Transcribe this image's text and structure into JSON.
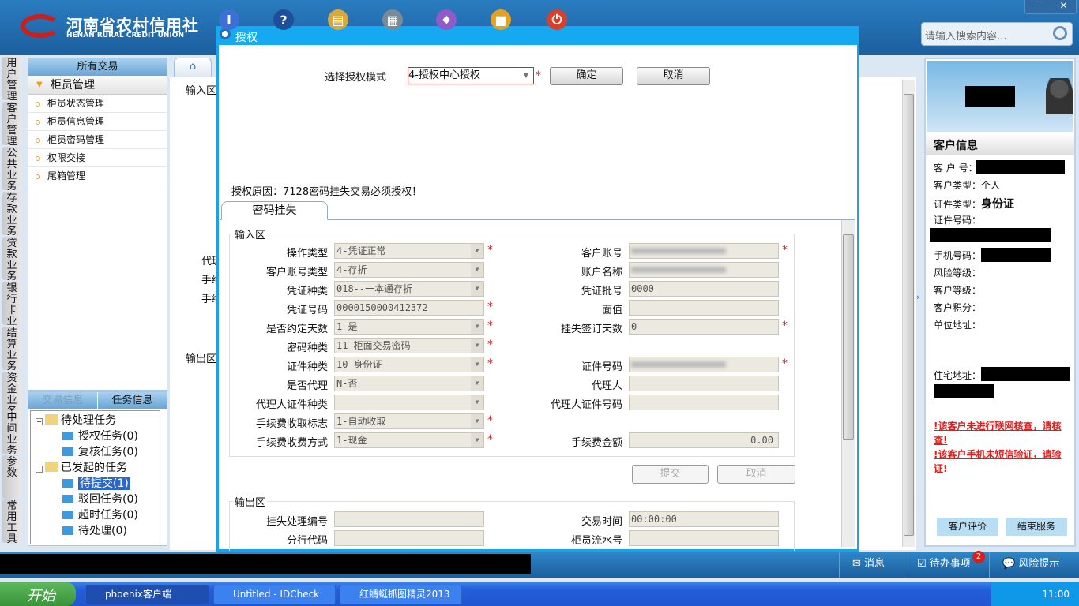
{
  "header": {
    "logo_cn": "河南省农村信用社",
    "logo_en": "HENAN RURAL CREDIT UNION",
    "search_placeholder": "请输入搜索内容...",
    "min": "—",
    "close": "✕",
    "icons": [
      {
        "name": "info-icon",
        "glyph": "i",
        "color": "#3d6fd6"
      },
      {
        "name": "help-icon",
        "glyph": "?",
        "color": "#1d4f9a"
      },
      {
        "name": "toolbox-icon",
        "glyph": "▤",
        "color": "#d9a73a"
      },
      {
        "name": "calculator-icon",
        "glyph": "▦",
        "color": "#7a8a96"
      },
      {
        "name": "skin-icon",
        "glyph": "♦",
        "color": "#8e5bc9"
      },
      {
        "name": "lock-icon",
        "glyph": "■",
        "color": "#e6a21f"
      },
      {
        "name": "power-icon",
        "glyph": "⏻",
        "color": "#d9402b"
      }
    ]
  },
  "vtabs": [
    "用户管理",
    "客户管理",
    "公共业务",
    "存款业务",
    "贷款业务",
    "银行卡业务",
    "结算业务",
    "资金业务",
    "中间业务",
    "参数",
    "常用工具"
  ],
  "sidebar": {
    "title": "所有交易",
    "group": "柜员管理",
    "items": [
      "柜员状态管理",
      "柜员信息管理",
      "柜员密码管理",
      "权限交接",
      "尾箱管理"
    ]
  },
  "tasks": {
    "tabs": [
      "交易信息",
      "任务信息"
    ],
    "tree": [
      {
        "label": "待处理任务",
        "level": 0
      },
      {
        "label": "授权任务(0)",
        "level": 1
      },
      {
        "label": "复核任务(0)",
        "level": 1
      },
      {
        "label": "已发起的任务",
        "level": 0
      },
      {
        "label": "待提交(1)",
        "level": 1,
        "selected": true
      },
      {
        "label": "驳回任务(0)",
        "level": 1
      },
      {
        "label": "超时任务(0)",
        "level": 1
      },
      {
        "label": "待处理(0)",
        "level": 1
      }
    ]
  },
  "background": {
    "labels": [
      "输入区",
      "输出区",
      "代理",
      "手续",
      "手续"
    ]
  },
  "dialog": {
    "title": "授权",
    "mode_label": "选择授权模式",
    "mode_value": "4-授权中心授权",
    "ok": "确定",
    "cancel": "取消",
    "reason": "授权原因：7128密码挂失交易必须授权！",
    "tab": "密码挂失",
    "input_legend": "输入区",
    "output_legend": "输出区",
    "submit": "提交",
    "cancel2": "取消",
    "left_fields": [
      {
        "label": "操作类型",
        "value": "4-凭证正常",
        "select": true,
        "req": true
      },
      {
        "label": "客户账号类型",
        "value": "4-存折",
        "select": true,
        "req": false
      },
      {
        "label": "凭证种类",
        "value": "018--一本通存折",
        "select": true,
        "req": false
      },
      {
        "label": "凭证号码",
        "value": "0000150000412372",
        "select": false,
        "req": true
      },
      {
        "label": "是否约定天数",
        "value": "1-是",
        "select": true,
        "req": true
      },
      {
        "label": "密码种类",
        "value": "11-柜面交易密码",
        "select": true,
        "req": true
      },
      {
        "label": "证件种类",
        "value": "10-身份证",
        "select": true,
        "req": true
      },
      {
        "label": "是否代理",
        "value": "N-否",
        "select": true,
        "req": false
      },
      {
        "label": "代理人证件种类",
        "value": "",
        "select": true,
        "req": false
      },
      {
        "label": "手续费收取标志",
        "value": "1-自动收取",
        "select": true,
        "req": true
      },
      {
        "label": "手续费收费方式",
        "value": "1-现金",
        "select": true,
        "req": true
      }
    ],
    "right_fields": [
      {
        "row": 0,
        "label": "客户账号",
        "value": "",
        "blurred": true,
        "req": true
      },
      {
        "row": 1,
        "label": "账户名称",
        "value": "",
        "blurred": true,
        "req": false
      },
      {
        "row": 2,
        "label": "凭证批号",
        "value": "0000",
        "req": false
      },
      {
        "row": 3,
        "label": "面值",
        "value": "",
        "req": false
      },
      {
        "row": 4,
        "label": "挂失签订天数",
        "value": "0",
        "req": true
      },
      {
        "row": 6,
        "label": "证件号码",
        "value": "",
        "blurred": true,
        "req": true
      },
      {
        "row": 7,
        "label": "代理人",
        "value": "",
        "req": false
      },
      {
        "row": 8,
        "label": "代理人证件号码",
        "value": "",
        "req": false
      },
      {
        "row": 10,
        "label": "手续费金额",
        "value": "0.00",
        "req": false,
        "alignRight": true
      }
    ],
    "output_left": [
      {
        "label": "挂失处理编号",
        "value": ""
      },
      {
        "label": "分行代码",
        "value": ""
      }
    ],
    "output_right": [
      {
        "label": "交易时间",
        "value": "00:00:00"
      },
      {
        "label": "柜员流水号",
        "value": ""
      }
    ]
  },
  "customer": {
    "title": "客户信息",
    "rows": [
      {
        "label": "客 户 号：",
        "value": ""
      },
      {
        "label": "客户类型：",
        "value": "个人"
      },
      {
        "label": "证件类型：",
        "value": "身份证"
      },
      {
        "label": "证件号码：",
        "value": ""
      },
      {
        "label": "手机号码：",
        "value": ""
      },
      {
        "label": "风险等级：",
        "value": ""
      },
      {
        "label": "客户等级：",
        "value": ""
      },
      {
        "label": "客户积分：",
        "value": ""
      },
      {
        "label": "单位地址：",
        "value": ""
      },
      {
        "label": "住宅地址：",
        "value": ""
      }
    ],
    "warnings": [
      "!该客户未进行联网核查，请核查!",
      "!该客户手机未短信验证，请验证!"
    ],
    "evaluate": "客户评价",
    "end": "结束服务"
  },
  "bottombar": {
    "message": "消息",
    "todo": "待办事项",
    "todo_count": "2",
    "risk": "风险提示"
  },
  "taskbar": {
    "start": "开始",
    "items": [
      "phoenix客户端",
      "Untitled - IDCheck",
      "红蜻蜓抓图精灵2013"
    ],
    "time": "11:00"
  }
}
